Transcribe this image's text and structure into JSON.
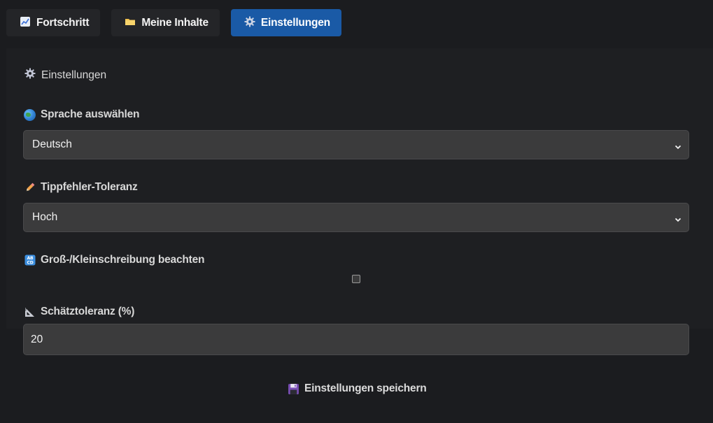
{
  "tabs": [
    {
      "label": "Fortschritt",
      "icon": "chart-icon",
      "active": false
    },
    {
      "label": "Meine Inhalte",
      "icon": "folder-icon",
      "active": false
    },
    {
      "label": "Einstellungen",
      "icon": "gear-icon",
      "active": true
    }
  ],
  "settings": {
    "title": "Einstellungen",
    "language": {
      "label": "Sprache auswählen",
      "icon": "globe-icon",
      "value": "Deutsch"
    },
    "typo_tolerance": {
      "label": "Tippfehler-Toleranz",
      "icon": "pencil-icon",
      "value": "Hoch"
    },
    "case_sensitive": {
      "label": "Groß-/Kleinschreibung beachten",
      "icon": "abcd-icon",
      "checked": false
    },
    "estimate_tolerance": {
      "label": "Schätztoleranz (%)",
      "icon": "triangle-ruler-icon",
      "value": "20"
    },
    "save_label": "Einstellungen speichern"
  },
  "colors": {
    "background": "#1b1c1f",
    "panel": "#1e1f22",
    "tab": "#242528",
    "tab_active": "#1a5aa6",
    "field": "#3b3b3c"
  }
}
